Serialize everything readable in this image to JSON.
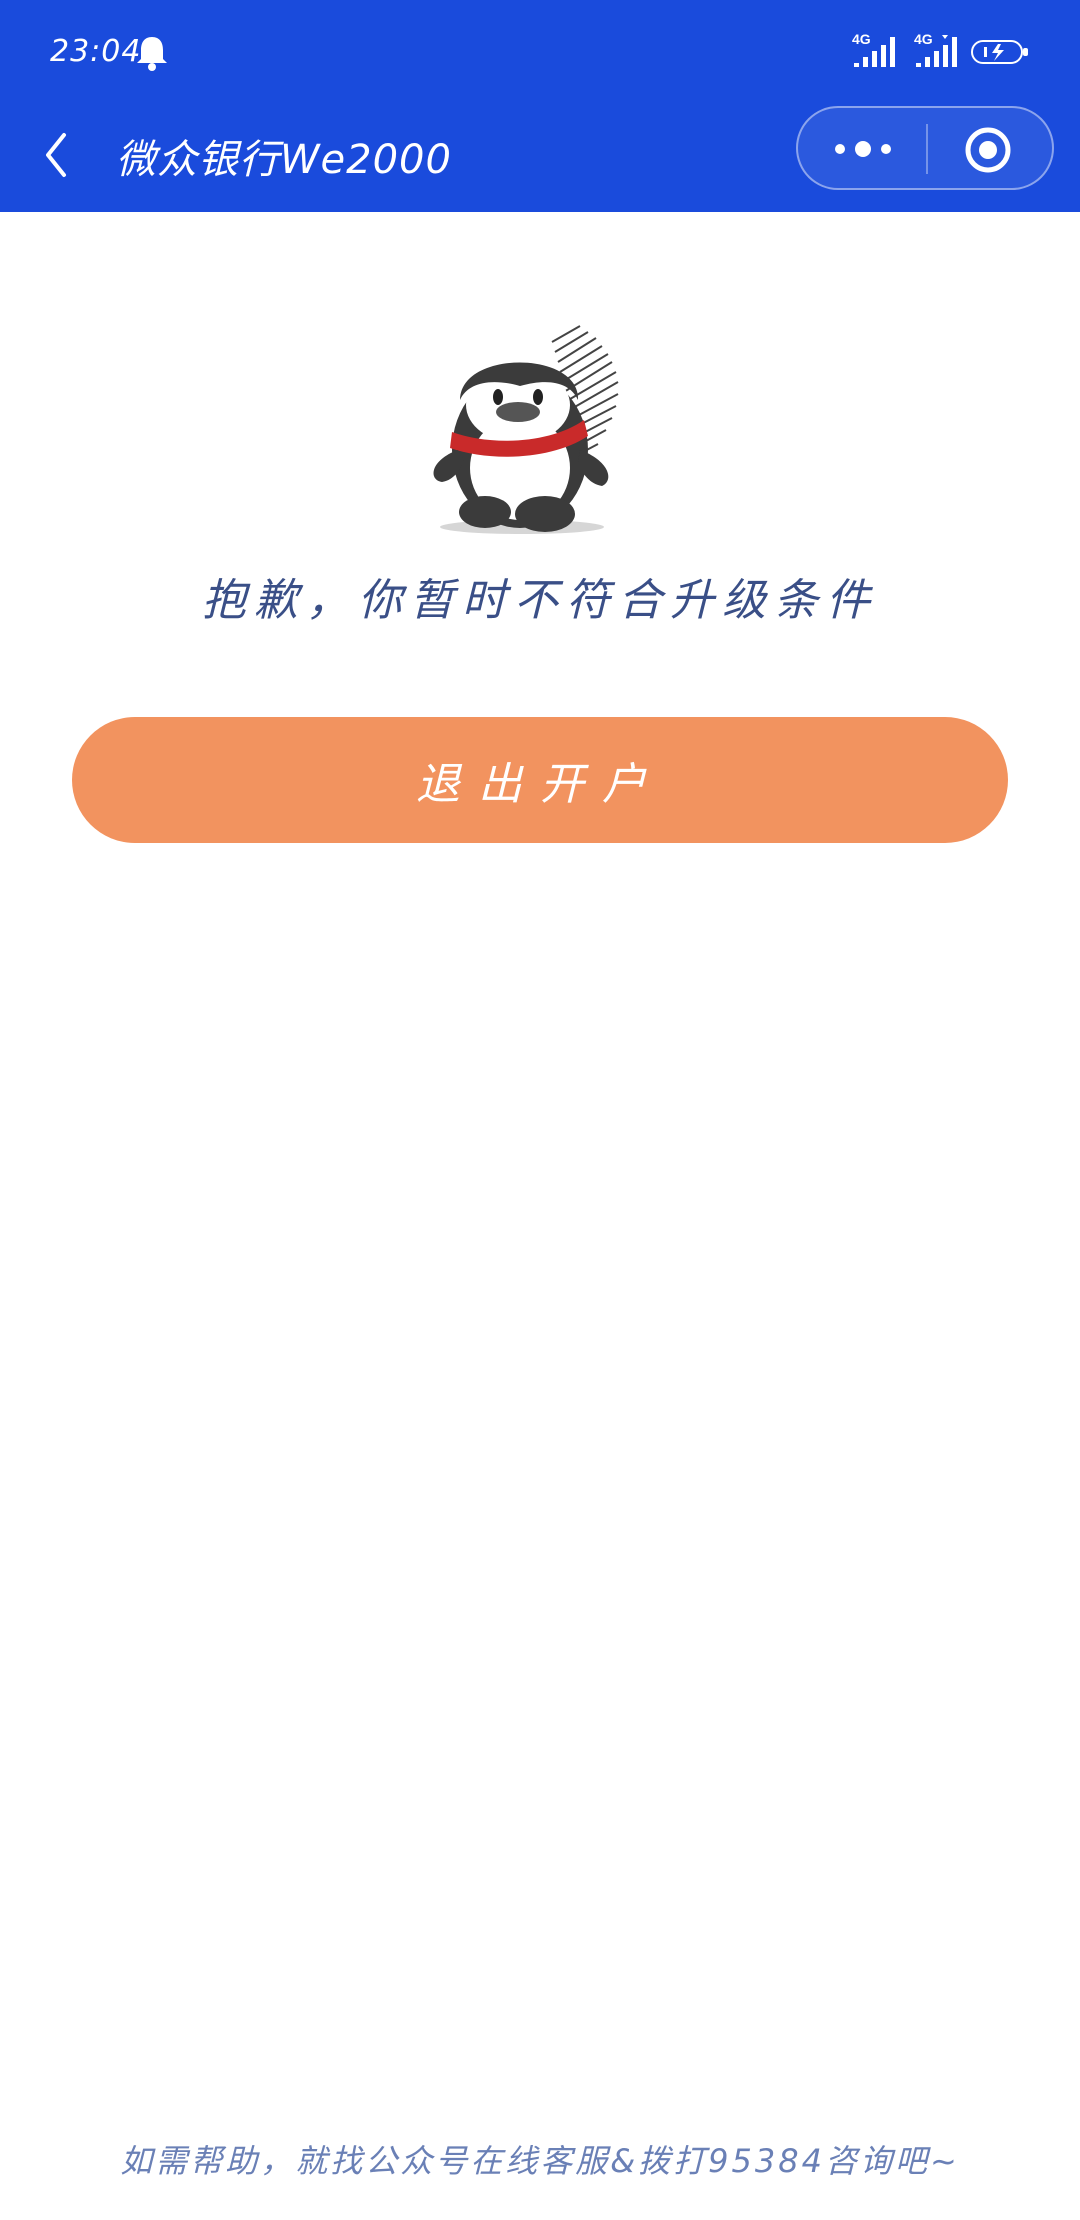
{
  "status_bar": {
    "time": "23:04",
    "network_1": "4G",
    "network_2": "4G",
    "icons": [
      "bell-icon",
      "signal-icon",
      "signal-icon",
      "battery-icon"
    ]
  },
  "navbar": {
    "title": "微众银行We2000",
    "back_icon": "chevron-left-icon",
    "more_icon": "more-icon",
    "close_icon": "close-mini-program-icon"
  },
  "content": {
    "illustration": "penguin-illustration",
    "message": "抱歉，你暂时不符合升级条件",
    "exit_button_label": "退出开户"
  },
  "footer": {
    "help_text": "如需帮助，就找公众号在线客服&拨打95384咨询吧~"
  },
  "colors": {
    "header_blue": "#1a4bdc",
    "button_orange": "#f2935f",
    "message_text": "#3a4f87",
    "footer_text": "#6a80b6"
  }
}
